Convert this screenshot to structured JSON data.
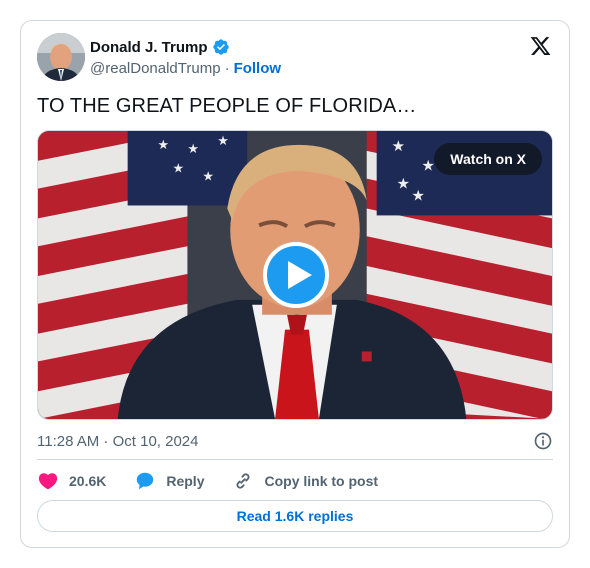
{
  "author": {
    "name": "Donald J. Trump",
    "handle": "@realDonaldTrump",
    "separator": "·",
    "follow_label": "Follow"
  },
  "tweet": {
    "text": "TO THE GREAT PEOPLE OF FLORIDA…"
  },
  "media": {
    "watch_label": "Watch on X"
  },
  "meta": {
    "timestamp": "11:28 AM · Oct 10, 2024"
  },
  "actions": {
    "likes": "20.6K",
    "reply_label": "Reply",
    "copy_label": "Copy link to post"
  },
  "footer": {
    "replies_label": "Read 1.6K replies"
  },
  "icons": {
    "verified": "verified-badge-icon",
    "x_logo": "x-logo-icon",
    "play": "play-icon",
    "info": "info-icon",
    "heart": "heart-icon",
    "reply": "speech-bubble-icon",
    "link": "link-icon"
  },
  "colors": {
    "accent": "#1d9bf0",
    "link": "#006fd6",
    "like": "#f91880",
    "muted": "#536471",
    "border": "#cfd9de"
  }
}
